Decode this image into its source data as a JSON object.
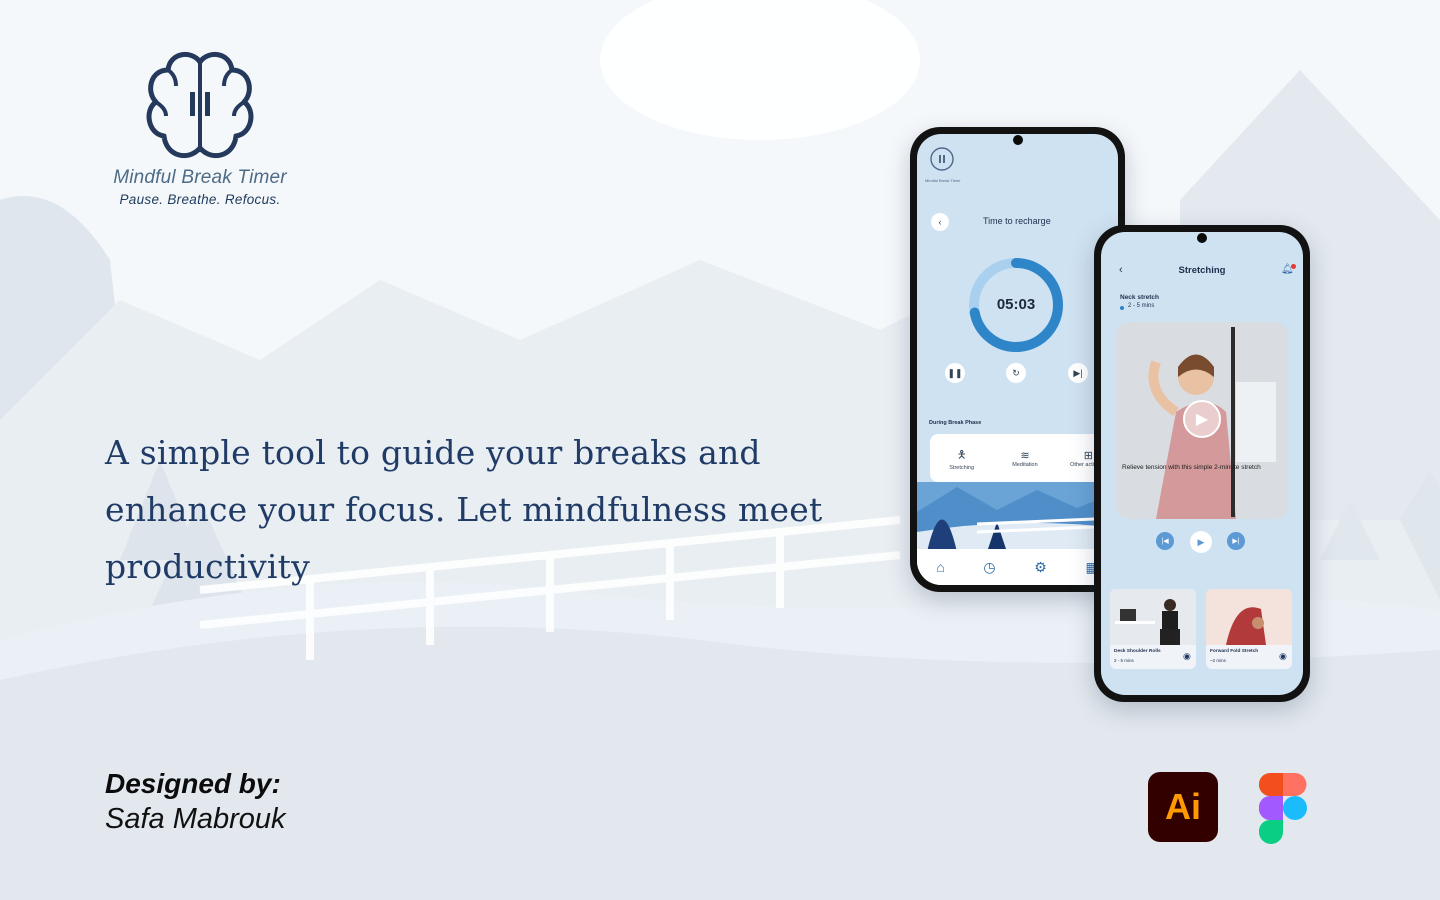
{
  "brand": {
    "name": "Mindful Break Timer",
    "tagline": "Pause. Breathe. Refocus."
  },
  "headline": "A simple tool to guide your breaks and enhance your focus. Let mindfulness meet productivity",
  "credits": {
    "designed_by_label": "Designed by:",
    "designer": "Safa Mabrouk"
  },
  "tools": {
    "illustrator_label": "Ai"
  },
  "timer_screen": {
    "app_name": "Mindful Break Timer",
    "title": "Time to recharge",
    "time": "05:03",
    "progress": 0.72,
    "section_label": "During Break Phase",
    "activities": [
      "Stretching",
      "Meditation",
      "Other activities"
    ]
  },
  "stretch_screen": {
    "title": "Stretching",
    "exercise_name": "Neck stretch",
    "exercise_duration": "2 - 5 mins",
    "video_caption": "Relieve tension with this simple 2-minute stretch",
    "related": [
      {
        "name": "Desk Shoulder Rolls",
        "duration": "2 - 5 mins"
      },
      {
        "name": "Forward Fold Stretch",
        "duration": "~2 mins"
      }
    ]
  },
  "colors": {
    "primary": "#1f3b66",
    "accent": "#2e86c9",
    "screen_bg": "#cfe2f1",
    "illustrator_bg": "#330000",
    "illustrator_fg": "#ff9a00"
  }
}
